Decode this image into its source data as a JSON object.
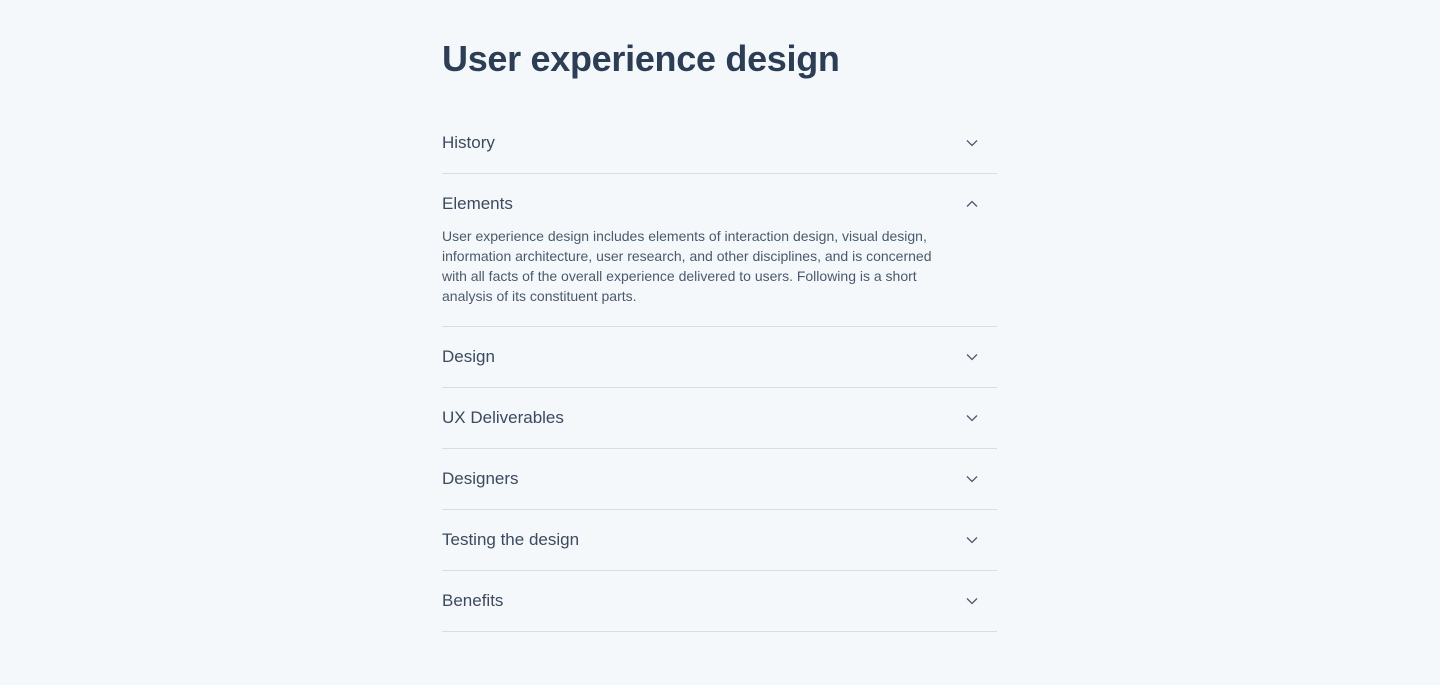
{
  "page": {
    "title": "User experience design"
  },
  "accordion": {
    "items": [
      {
        "label": "History",
        "expanded": false,
        "icon": "chevron-down-icon"
      },
      {
        "label": "Elements",
        "expanded": true,
        "icon": "chevron-up-icon",
        "content": "User experience design includes elements of interaction design, visual design, information architecture, user research, and other disciplines, and is concerned with all facts of the overall experience delivered to users. Following is a short analysis of its constituent parts."
      },
      {
        "label": "Design",
        "expanded": false,
        "icon": "chevron-down-icon"
      },
      {
        "label": "UX Deliverables",
        "expanded": false,
        "icon": "chevron-down-icon"
      },
      {
        "label": "Designers",
        "expanded": false,
        "icon": "chevron-down-icon"
      },
      {
        "label": "Testing the design",
        "expanded": false,
        "icon": "chevron-down-icon"
      },
      {
        "label": "Benefits",
        "expanded": false,
        "icon": "chevron-down-icon"
      }
    ]
  },
  "colors": {
    "background": "#f5f8fb",
    "title": "#2c3e55",
    "text": "#3b4a5e",
    "divider": "#d5dde6"
  }
}
